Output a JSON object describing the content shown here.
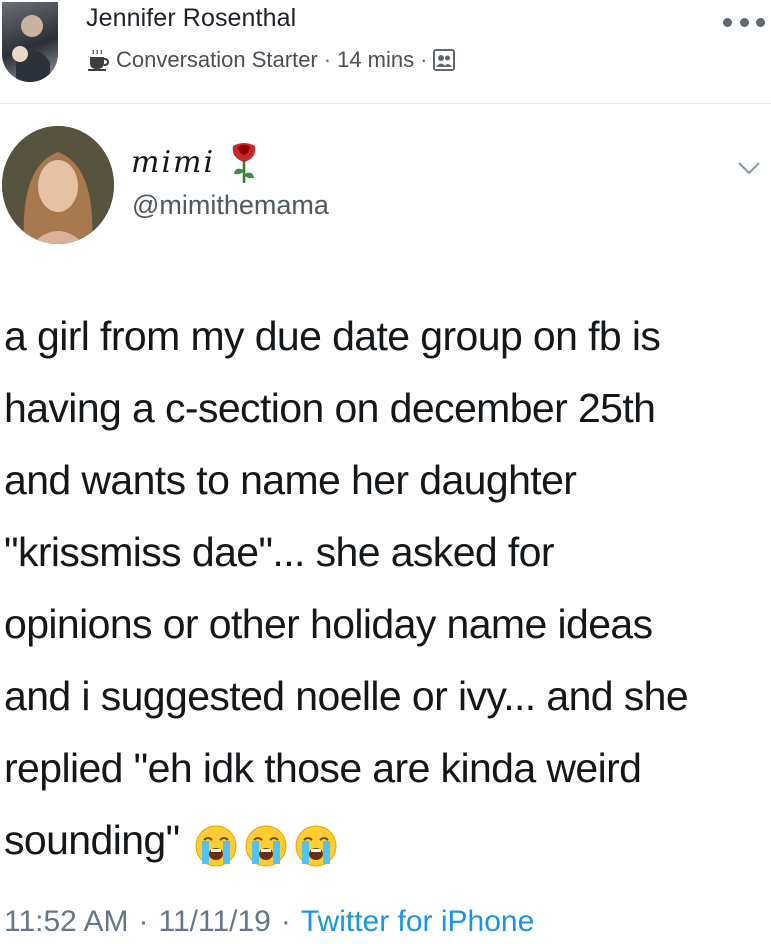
{
  "fb_post": {
    "author": "Jennifer Rosenthal",
    "badge_icon": "coffee-cup-icon",
    "badge_label": "Conversation Starter",
    "separator": "·",
    "time": "14 mins",
    "audience_icon": "friends-audience-icon",
    "more_icon": "more-options-icon"
  },
  "tweet": {
    "display_name": "mimi",
    "name_emoji_icon": "rose-icon",
    "handle": "@mimithemama",
    "caret_icon": "chevron-down-icon",
    "body_lines": [
      "a girl from my due date group on fb is",
      "having a c-section on december 25th",
      "and wants to name her daughter",
      "\"krissmiss dae\"... she asked for",
      "opinions or other holiday name ideas",
      "and i suggested noelle or ivy... and she",
      "replied \"eh idk those are kinda weird",
      "sounding\""
    ],
    "trailing_emoji_icons": [
      "loudly-crying-face-icon",
      "loudly-crying-face-icon",
      "loudly-crying-face-icon"
    ],
    "time": "11:52 AM",
    "separator": "·",
    "date": "11/11/19",
    "source": "Twitter for iPhone"
  },
  "colors": {
    "tweet_link": "#1b95e0",
    "meta_gray": "#657786",
    "text": "#14171a"
  }
}
